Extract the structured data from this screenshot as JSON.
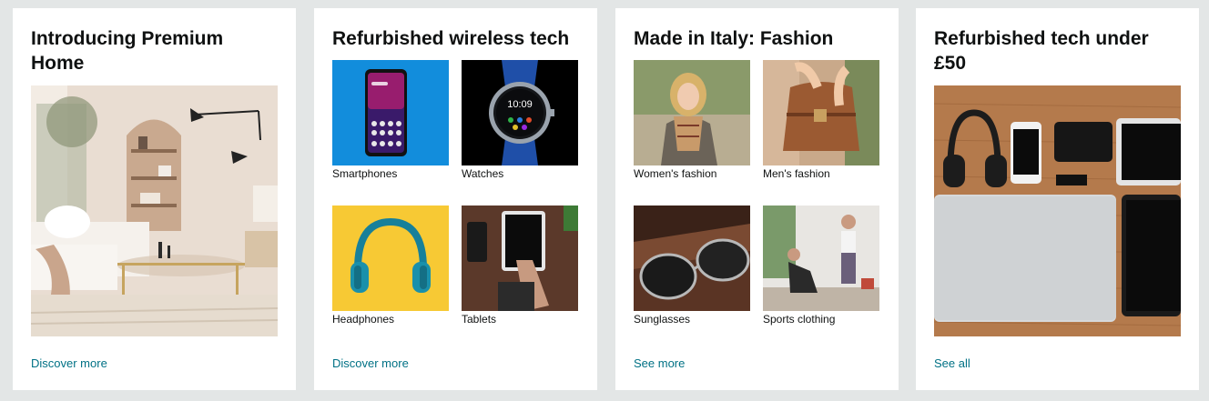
{
  "cards": [
    {
      "title": "Introducing Premium Home",
      "link": "Discover more"
    },
    {
      "title": "Refurbished wireless tech",
      "tiles": [
        "Smartphones",
        "Watches",
        "Headphones",
        "Tablets"
      ],
      "link": "Discover more"
    },
    {
      "title": "Made in Italy: Fashion",
      "tiles": [
        "Women's fashion",
        "Men's fashion",
        "Sunglasses",
        "Sports clothing"
      ],
      "link": "See more"
    },
    {
      "title": "Refurbished tech under £50",
      "link": "See all"
    }
  ],
  "watch_time": "10:09",
  "colors": {
    "background": "#e3e6e6",
    "card": "#ffffff",
    "link": "#007185",
    "text": "#0f1111"
  }
}
